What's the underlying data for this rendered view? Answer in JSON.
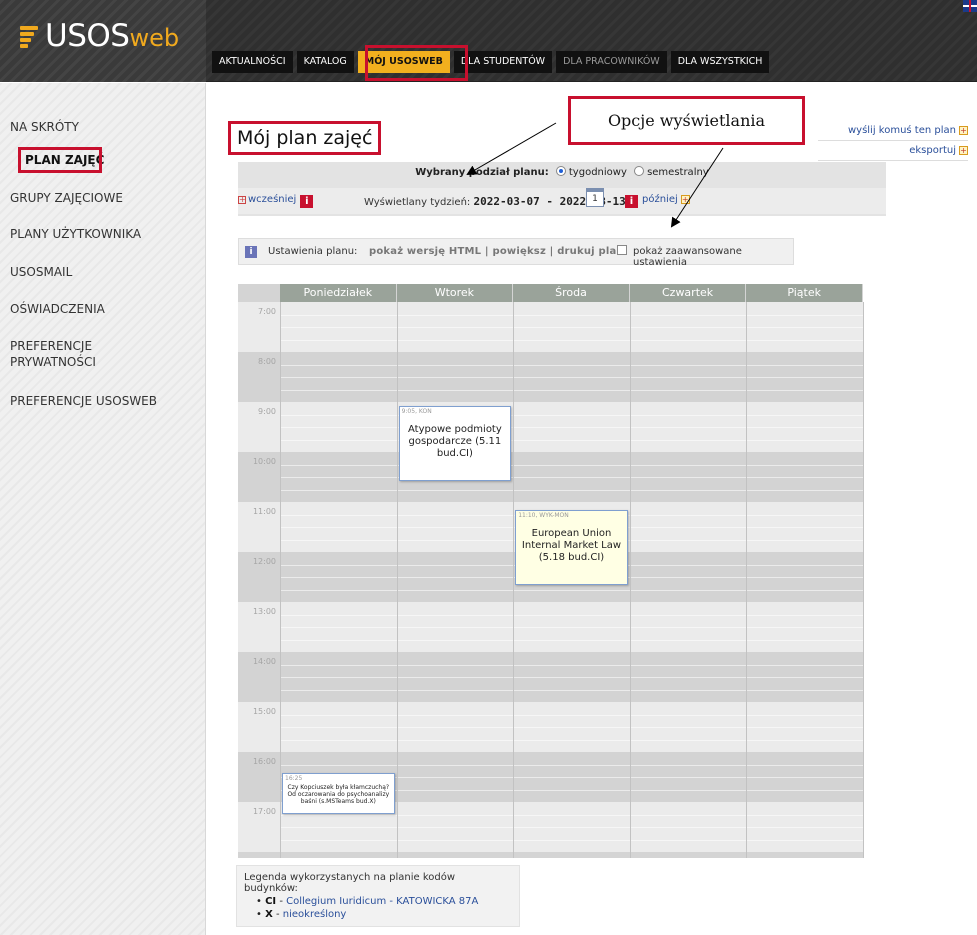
{
  "header": {
    "logo_main": "USOS",
    "logo_sub": "web",
    "tabs": [
      {
        "label": "AKTUALNOŚCI"
      },
      {
        "label": "KATALOG"
      },
      {
        "label": "MÓJ USOSWEB"
      },
      {
        "label": "DLA STUDENTÓW"
      },
      {
        "label": "DLA PRACOWNIKÓW"
      },
      {
        "label": "DLA WSZYSTKICH"
      }
    ],
    "active_tab": "MÓJ USOSWEB",
    "language_flag": "uk-flag-icon"
  },
  "sidebar": {
    "items": [
      {
        "label": "NA SKRÓTY"
      },
      {
        "label": "PLAN ZAJĘĆ"
      },
      {
        "label": "GRUPY ZAJĘCIOWE"
      },
      {
        "label": "PLANY UŻYTKOWNIKA"
      },
      {
        "label": "USOSMAIL"
      },
      {
        "label": "OŚWIADCZENIA"
      },
      {
        "label": "PREFERENCJE\nPRYWATNOŚCI"
      },
      {
        "label": "PREFERENCJE USOSWEB"
      }
    ],
    "active_item": "PLAN ZAJĘĆ"
  },
  "main": {
    "title": "Mój plan zajęć",
    "callout": "Opcje wyświetlania",
    "right_links": [
      "wyślij komuś ten plan",
      "eksportuj"
    ],
    "split": {
      "label": "Wybrany podział planu:",
      "options": [
        "tygodniowy",
        "semestralny"
      ],
      "selected": "tygodniowy"
    },
    "week": {
      "earlier": "wcześniej",
      "label": "Wyświetlany tydzień:",
      "value": "2022-03-07 - 2022-03-13",
      "calendar_day": "1",
      "later": "później"
    },
    "settings": {
      "label": "Ustawienia planu:",
      "html_link": "pokaż wersję HTML",
      "zoom_link": "powiększ",
      "print_link": "drukuj plan",
      "advanced": "pokaż zaawansowane ustawienia",
      "advanced_checked": false
    }
  },
  "timetable": {
    "days": [
      "Poniedziałek",
      "Wtorek",
      "Środa",
      "Czwartek",
      "Piątek"
    ],
    "hours": [
      "7:00",
      "8:00",
      "9:00",
      "10:00",
      "11:00",
      "12:00",
      "13:00",
      "14:00",
      "15:00",
      "16:00",
      "17:00"
    ],
    "events": [
      {
        "day": "Wtorek",
        "start": "9:05",
        "type": "KON",
        "header": "9:05, KON",
        "title": "Atypowe podmioty gospodarcze (5.11 bud.CI)",
        "end": "10:35"
      },
      {
        "day": "Środa",
        "start": "11:10",
        "type": "WYK-MON",
        "header": "11:10, WYK-MON",
        "title": "European Union Internal Market Law (5.18 bud.CI)",
        "end": "12:40"
      },
      {
        "day": "Poniedziałek",
        "start": "16:25",
        "type": "",
        "header": "16:25",
        "title": "Czy Kopciuszek była kłamczuchą? Od oczarowania do psychoanalizy baśni (s.MSTeams bud.X)",
        "end": "17:15"
      }
    ]
  },
  "legend": {
    "title": "Legenda wykorzystanych na planie kodów budynków:",
    "items": [
      {
        "code": "CI",
        "value": "Collegium Iuridicum - KATOWICKA 87A"
      },
      {
        "code": "X",
        "value": "nieokreślony"
      }
    ]
  }
}
